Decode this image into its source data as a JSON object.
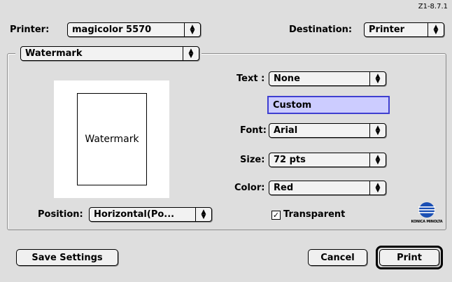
{
  "header": {
    "ref_code": "Z1-8.7.1",
    "printer_label": "Printer:",
    "printer_value": "magicolor 5570",
    "destination_label": "Destination:",
    "destination_value": "Printer"
  },
  "panel": {
    "section_value": "Watermark",
    "preview_text": "Watermark",
    "position_label": "Position:",
    "position_value": "Horizontal(Po...",
    "text_label": "Text :",
    "text_value": "None",
    "custom_text_value": "Custom",
    "font_label": "Font:",
    "font_value": "Arial",
    "size_label": "Size:",
    "size_value": "72 pts",
    "color_label": "Color:",
    "color_value": "Red",
    "transparent_label": "Transparent",
    "transparent_checked": true,
    "logo_text": "KONICA MINOLTA"
  },
  "footer": {
    "save_settings_label": "Save Settings",
    "cancel_label": "Cancel",
    "print_label": "Print"
  },
  "colors": {
    "window_bg": "#dedede",
    "text_field_bg": "#ccccff",
    "text_field_border": "#3f3fd0",
    "logo_blue": "#1a4fb4"
  }
}
